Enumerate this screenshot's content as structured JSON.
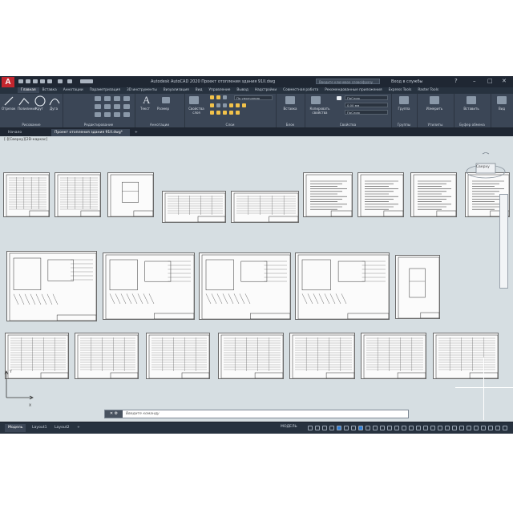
{
  "titlebar": {
    "app_letter": "A",
    "title": "Autodesk AutoCAD 2020    Проект отопления здания 91II.dwg",
    "search_placeholder": "Введите ключевое слово/фразу",
    "signin": "Вход в службы"
  },
  "ribbon_tabs": [
    "Главная",
    "Вставка",
    "Аннотации",
    "Параметризация",
    "3D инструменты",
    "Визуализация",
    "Вид",
    "Управление",
    "Вывод",
    "Надстройки",
    "Совместная работа",
    "Рекомендованные приложения",
    "Express Tools",
    "Raster Tools"
  ],
  "ribbon": {
    "draw": {
      "label": "Рисование",
      "tools": [
        "Отрезок",
        "Полилиния",
        "Круг",
        "Дуга"
      ]
    },
    "modify": {
      "label": "Редактирование"
    },
    "annotation": {
      "label": "Аннотации",
      "tools": [
        "Текст",
        "Размер"
      ]
    },
    "layers": {
      "label": "Слои",
      "tool": "Свойства слоя",
      "current_layer": "По умолчанию"
    },
    "block": {
      "label": "Блок",
      "tool": "Вставка"
    },
    "properties": {
      "label": "Свойства",
      "tool": "Копировать свойства",
      "color": "ПоСлою",
      "lineweight": "0.00 мм",
      "linetype": "ПоСлою"
    },
    "groups": {
      "label": "Группы",
      "tool": "Группа"
    },
    "utilities": {
      "label": "Утилиты",
      "tool": "Измерить"
    },
    "clipboard": {
      "label": "Буфер обмена",
      "tool": "Вставить"
    },
    "view": {
      "label": "Вид",
      "tool": "Вид"
    }
  },
  "file_tabs": {
    "start": "Начало",
    "file": "Проект отопления здания 91II.dwg*",
    "add": "+"
  },
  "canvas": {
    "viewport_label": "[-][Сверху][2D-каркас]",
    "viewcube_label": "Сверху",
    "command_prompt": "Введите команду"
  },
  "ucs": {
    "x": "X",
    "y": "Y"
  },
  "statusbar": {
    "layout_tabs": [
      "Модель",
      "Layout1",
      "Layout2"
    ],
    "add": "+",
    "model_button": "МОДЕЛЬ"
  },
  "colors": {
    "accent": "#c4262e",
    "canvas": "#d6dee2",
    "ui_dark": "#27323f",
    "ribbon": "#3b4656"
  }
}
